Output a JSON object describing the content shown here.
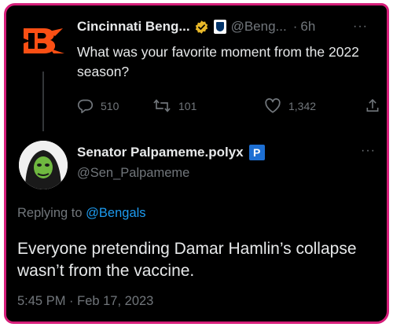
{
  "original_tweet": {
    "display_name": "Cincinnati Beng...",
    "handle": "@Beng...",
    "time_sep": "·",
    "time_ago": "6h",
    "more": "···",
    "text": "What was your favorite moment from the 2022 season?",
    "stats": {
      "replies": "510",
      "retweets": "101",
      "likes": "1,342"
    },
    "colors": {
      "logo_orange": "#fb4f14",
      "verified_gold": "#e8b829"
    }
  },
  "reply_tweet": {
    "display_name": "Senator Palpameme.polyx",
    "badge": "P",
    "handle": "@Sen_Palpameme",
    "more": "···",
    "replying_prefix": "Replying to",
    "replying_handle": "@Bengals",
    "text": "Everyone pretending Damar Hamlin’s collapse wasn’t from the vaccine.",
    "timestamp": "5:45 PM · Feb 17, 2023",
    "colors": {
      "badge_blue": "#1d6fd3",
      "link_blue": "#1d9bf0"
    }
  },
  "icons": {
    "reply": "reply-icon",
    "retweet": "retweet-icon",
    "like": "heart-icon",
    "share": "share-icon",
    "more": "more-icon",
    "verified": "verified-badge-icon",
    "affiliate": "nfl-badge-icon"
  },
  "frame_color": "#d61e7a"
}
